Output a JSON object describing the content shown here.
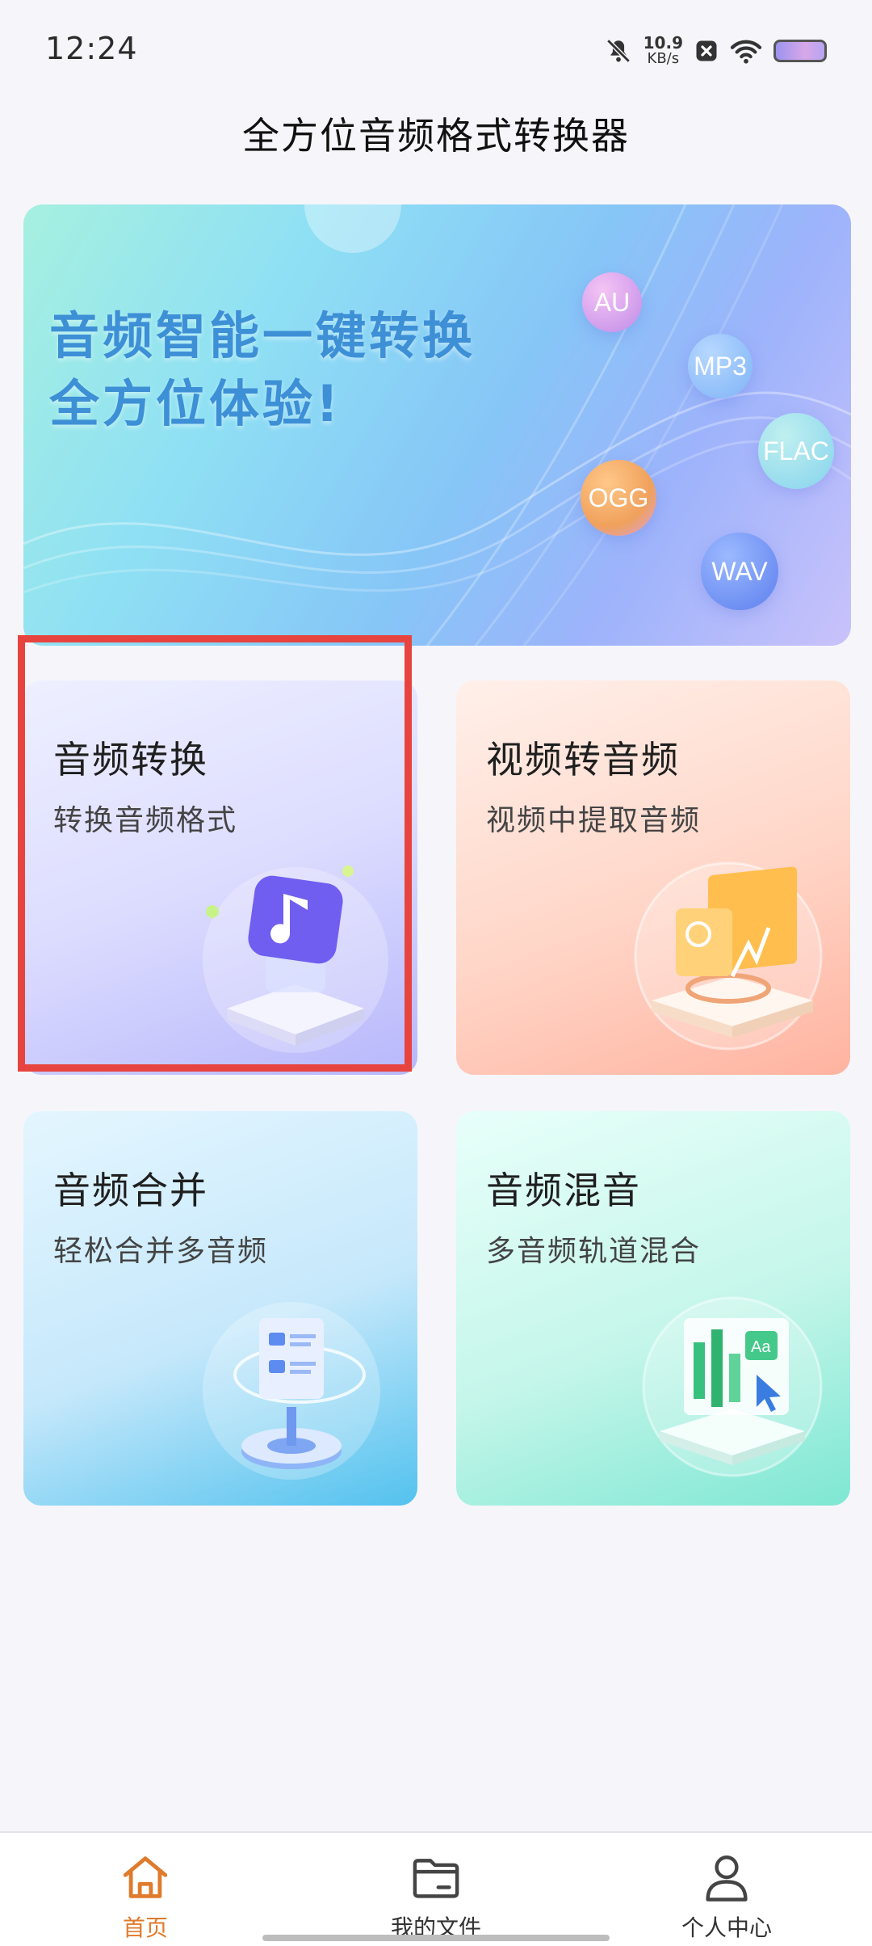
{
  "status_bar": {
    "time": "12:24",
    "net_speed_value": "10.9",
    "net_speed_unit": "KB/s",
    "icons": [
      "bell-muted-icon",
      "close-box-icon",
      "wifi-icon",
      "battery-icon"
    ]
  },
  "header": {
    "title": "全方位音频格式转换器"
  },
  "banner": {
    "line1": "音频智能一键转换",
    "line2": "全方位体验!",
    "formats": [
      "AU",
      "MP3",
      "FLAC",
      "OGG",
      "WAV"
    ]
  },
  "features": [
    {
      "title": "音频转换",
      "subtitle": "转换音频格式",
      "icon": "music-note-icon"
    },
    {
      "title": "视频转音频",
      "subtitle": "视频中提取音频",
      "icon": "video-extract-icon"
    },
    {
      "title": "音频合并",
      "subtitle": "轻松合并多音频",
      "icon": "merge-icon"
    },
    {
      "title": "音频混音",
      "subtitle": "多音频轨道混合",
      "icon": "mix-icon"
    }
  ],
  "bottom_nav": {
    "items": [
      {
        "label": "首页",
        "icon": "home-icon",
        "active": true
      },
      {
        "label": "我的文件",
        "icon": "folder-icon",
        "active": false
      },
      {
        "label": "个人中心",
        "icon": "person-icon",
        "active": false
      }
    ]
  },
  "colors": {
    "accent": "#e07a2c",
    "highlight": "#e8443f",
    "banner_text": "#3d8fd6"
  }
}
